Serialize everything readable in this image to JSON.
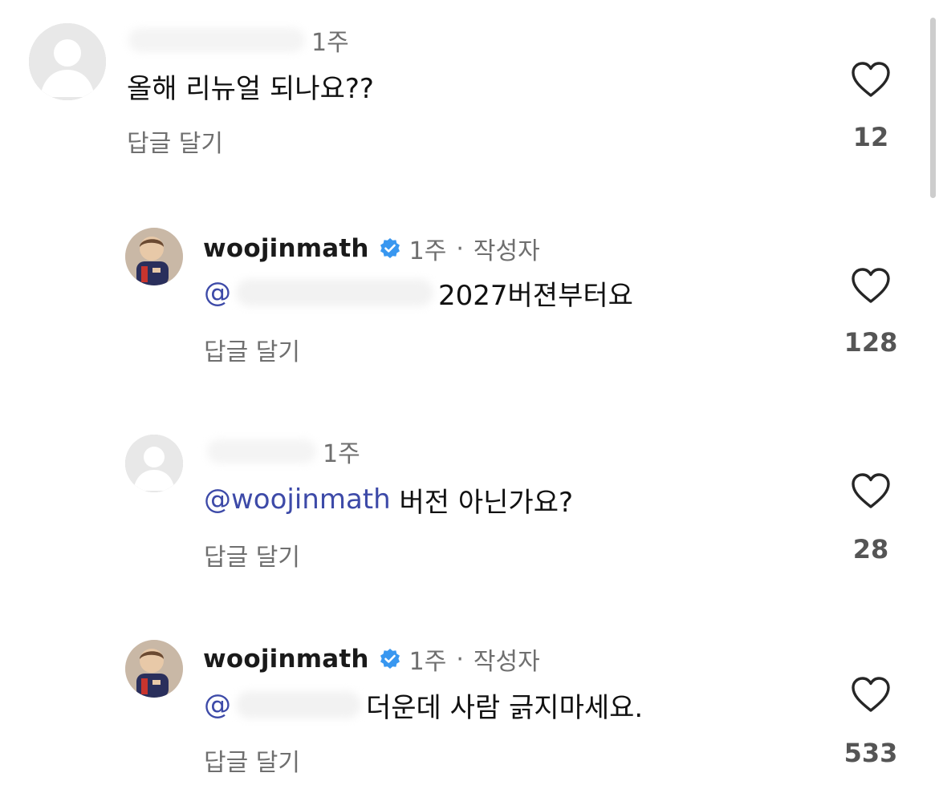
{
  "comments": [
    {
      "time": "1주",
      "text": "올해 리뉴얼 되나요??",
      "reply_label": "답글 달기",
      "likes": "12"
    },
    {
      "username": "woojinmath",
      "time": "1주",
      "dot": "·",
      "author_badge": "작성자",
      "mention": "@",
      "text": "2027버젼부터요",
      "reply_label": "답글 달기",
      "likes": "128"
    },
    {
      "time": "1주",
      "mention": "@woojinmath",
      "text": " 버전 아닌가요?",
      "reply_label": "답글 달기",
      "likes": "28"
    },
    {
      "username": "woojinmath",
      "time": "1주",
      "dot": "·",
      "author_badge": "작성자",
      "mention": "@",
      "text": "더운데 사람 긁지마세요.",
      "reply_label": "답글 달기",
      "likes": "533"
    }
  ],
  "icons": {
    "heart": "heart-outline-icon",
    "verified": "verified-badge-icon",
    "avatar_default": "default-avatar-icon"
  },
  "colors": {
    "mention": "#3d4aa8",
    "verified": "#3897f0",
    "muted": "#6f6f6f"
  }
}
